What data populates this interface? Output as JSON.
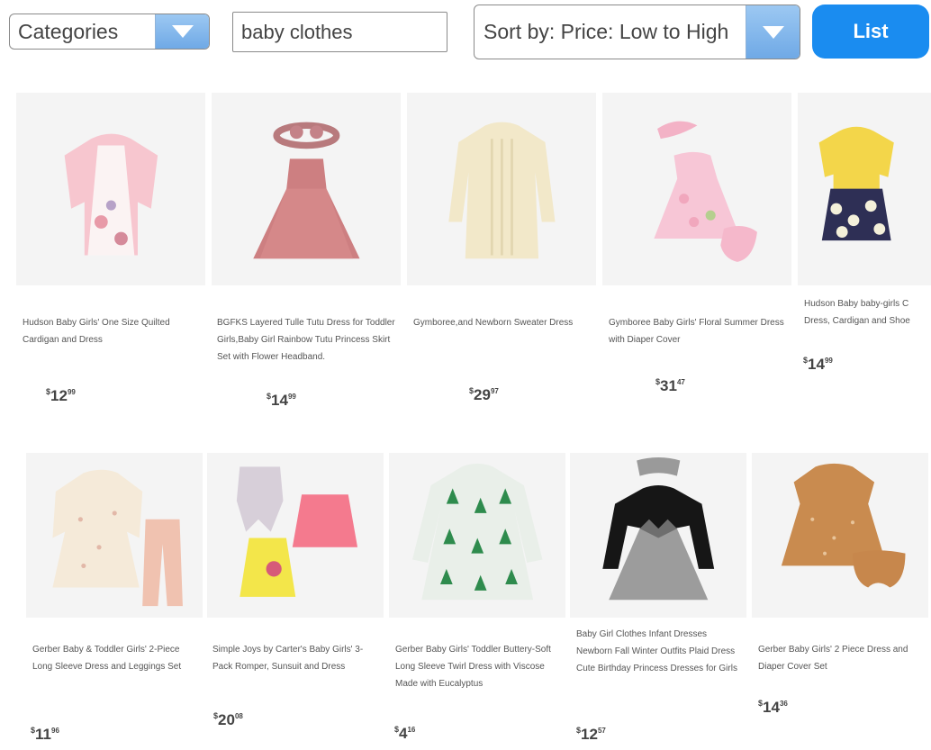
{
  "toolbar": {
    "categories_label": "Categories",
    "search_value": "baby clothes",
    "search_placeholder": "baby clothes",
    "sort_label": "Sort by: Price: Low to High",
    "list_label": "List"
  },
  "colors": {
    "accent": "#1a8cf0",
    "dropdown_arrow": "#7db4ea"
  },
  "products": [
    {
      "title": "Hudson Baby Girls' One Size Quilted Cardigan and Dress",
      "price_whole": "12",
      "price_frac": "99"
    },
    {
      "title": "BGFKS Layered Tulle Tutu Dress for Toddler Girls,Baby Girl Rainbow Tutu Princess Skirt Set with Flower Headband.",
      "price_whole": "14",
      "price_frac": "99"
    },
    {
      "title": "Gymboree,and Newborn Sweater Dress",
      "price_whole": "29",
      "price_frac": "97"
    },
    {
      "title": "Gymboree Baby Girls' Floral Summer Dress with Diaper Cover",
      "price_whole": "31",
      "price_frac": "47"
    },
    {
      "title": "Hudson Baby baby-girls C Dress, Cardigan and Shoe",
      "price_whole": "14",
      "price_frac": "99"
    },
    {
      "title": "Gerber Baby & Toddler Girls' 2-Piece Long Sleeve Dress and Leggings Set",
      "price_whole": "11",
      "price_frac": "96"
    },
    {
      "title": "Simple Joys by Carter's Baby Girls' 3-Pack Romper, Sunsuit and Dress",
      "price_whole": "20",
      "price_frac": "08"
    },
    {
      "title": "Gerber Baby Girls' Toddler Buttery-Soft Long Sleeve Twirl Dress with Viscose Made with Eucalyptus",
      "price_whole": "4",
      "price_frac": "16"
    },
    {
      "title": "Baby Girl Clothes Infant Dresses Newborn Fall Winter Outfits Plaid Dress Cute Birthday Princess Dresses for Girls",
      "price_whole": "12",
      "price_frac": "57"
    },
    {
      "title": "Gerber Baby Girls' 2 Piece Dress and Diaper Cover Set",
      "price_whole": "14",
      "price_frac": "36"
    }
  ]
}
